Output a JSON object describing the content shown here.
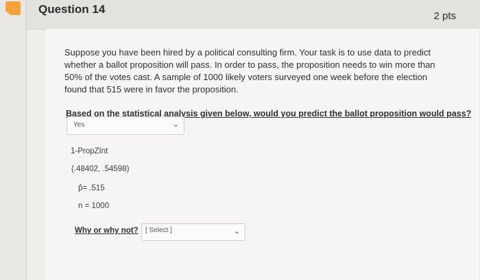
{
  "question": {
    "title": "Question 14",
    "points": "2 pts",
    "prompt": "Suppose you have been hired by a political consulting firm. Your task is to use data to predict whether a ballot proposition will pass. In order to pass, the proposition needs to win more than 50% of the votes cast. A sample of 1000 likely voters surveyed one week before the election found that 515 were in favor the proposition.",
    "sub_question": "Based on the statistical analysis given below, would you predict the ballot proposition would pass?",
    "answer_select": {
      "value": "Yes"
    },
    "analysis": {
      "method": "1-PropZInt",
      "interval": "(.48402, .54598)",
      "p_hat": "p̂= .515",
      "n": "n = 1000"
    },
    "why_label": "Why or why not?",
    "why_select": {
      "value": "[ Select ]"
    }
  },
  "icons": {
    "flag": "flag-icon",
    "dropdown": "chevron-down-icon"
  },
  "colors": {
    "flag": "#f2a33a",
    "header_bg": "#e4e2df"
  }
}
